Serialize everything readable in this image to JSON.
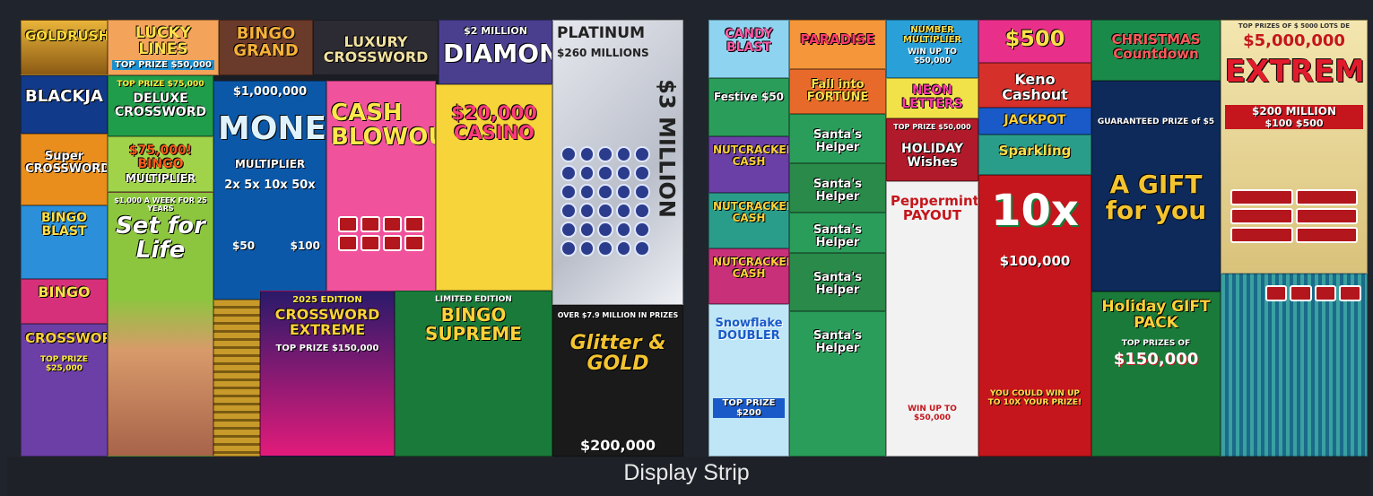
{
  "caption": "Display Strip",
  "left_tickets": {
    "goldrush": "GOLDRUSH",
    "lucky_lines": "LUCKY LINES",
    "lucky_prize": "TOP PRIZE $50,000",
    "bingo_grand": "BINGO GRAND",
    "luxury": "LUXURY CROSSWORD",
    "diamond_top": "$2 MILLION",
    "diamond": "DIAMOND",
    "platinum": "PLATINUM",
    "platinum_sub": "$260 MILLIONS",
    "platinum_side": "$3 MILLION",
    "blackjack": "BLACKJA",
    "deluxe_prize": "TOP PRIZE $75,000",
    "deluxe": "DELUXE CROSSWORD",
    "bingo75": "$75,000! BINGO",
    "multiplier": "MULTIPLIER",
    "million_top": "$1,000,000",
    "money": "MONEY",
    "money_sub": "MULTIPLIER",
    "money_mult": "2x 5x 10x 50x",
    "cash_blowout": "CASH BLOWOUT",
    "casino": "$20,000 CASINO",
    "super_crossword": "Super CROSSWORD",
    "bingo_blast": "BINGO BLAST",
    "set_for_life": "Set for Life",
    "set_for_life_top": "$1,000 A WEEK FOR 25 YEARS",
    "bingo_small": "BINGO",
    "crossword_small": "CROSSWORD",
    "crossword_prize": "TOP PRIZE $25,000",
    "cw_extreme_edition": "2025 EDITION",
    "cw_extreme": "CROSSWORD EXTREME",
    "cw_extreme_prize": "TOP PRIZE $150,000",
    "bingo_supreme_edition": "LIMITED EDITION",
    "bingo_supreme": "BINGO SUPREME",
    "glitter_top": "OVER $7.9 MILLION IN PRIZES",
    "glitter": "Glitter & GOLD",
    "glitter_prize": "$200,000",
    "money_50": "$50",
    "money_100": "$100"
  },
  "right_tickets": {
    "candy": "CANDY BLAST",
    "paradise": "PARADISE",
    "number_mult": "NUMBER MULTIPLIER",
    "number_mult_sub": "WIN UP TO $50,000",
    "s500": "$500",
    "christmas": "CHRISTMAS Countdown",
    "five_million_top": "TOP PRIZES OF $ 5000 LOTS DE",
    "five_million": "$5,000,000",
    "extreme": "EXTREME",
    "extreme_sub": "$200 MILLION",
    "extreme_amounts": "$100 $500",
    "fall": "Fall into FORTUNE",
    "festive": "Festive $50",
    "neon": "NEON LETTERS",
    "keno": "Keno Cashout",
    "jackpot": "JACKPOT",
    "nutcracker1": "NUTCRACKER CASH",
    "nutcracker2": "NUTCRACKER CASH",
    "nutcracker3": "NUTCRACKER CASH",
    "santas1": "Santa's Helper",
    "santas2": "Santa's Helper",
    "santas3": "Santa's Helper",
    "santas4": "Santa's Helper",
    "santas5": "Santa's Helper",
    "holiday_prize": "TOP PRIZE $50,000",
    "holiday_wishes": "HOLIDAY Wishes",
    "sparkling": "Sparkling",
    "gift_guarantee": "GUARANTEED PRIZE of $5",
    "gift": "A GIFT for you",
    "peppermint": "Peppermint PAYOUT",
    "peppermint_win": "WIN UP TO $50,000",
    "tenx": "10x",
    "tenx_prize": "$100,000",
    "tenx_bottom": "YOU COULD WIN UP TO 10X YOUR PRIZE!",
    "snowflake": "Snowflake DOUBLER",
    "snowflake_prize": "TOP PRIZE $200",
    "holiday_gift": "Holiday GIFT PACK",
    "holiday_gift_prize": "$150,000",
    "holiday_gift_top": "TOP PRIZES OF"
  },
  "colors": {
    "background": "#20242c",
    "money_green": "#2a9d3a",
    "red": "#c4161c",
    "gold": "#f4c430"
  }
}
